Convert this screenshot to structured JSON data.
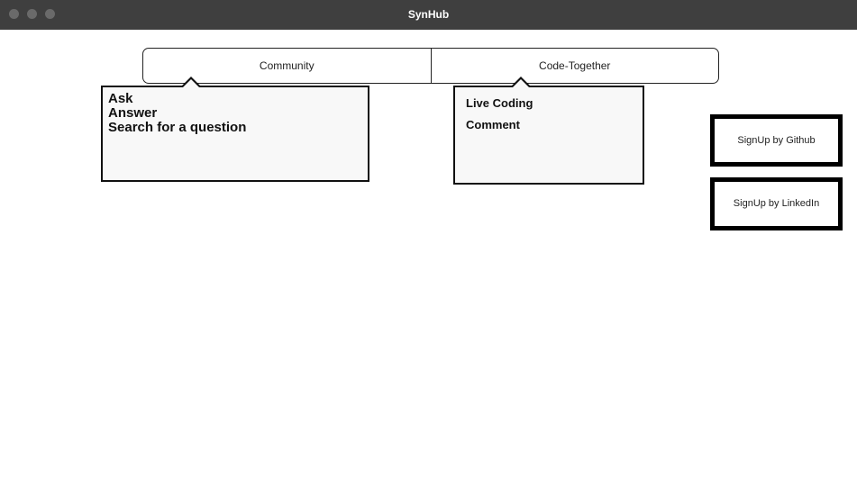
{
  "window": {
    "title": "SynHub"
  },
  "tabs": [
    {
      "label": "Community"
    },
    {
      "label": "Code-Together"
    }
  ],
  "community_menu": {
    "items": [
      {
        "label": "Ask"
      },
      {
        "label": "Answer"
      },
      {
        "label": "Search for a question"
      }
    ]
  },
  "code_menu": {
    "items": [
      {
        "label": "Live Coding"
      },
      {
        "label": "Comment"
      }
    ]
  },
  "signup": {
    "github_label": "SignUp by Github",
    "linkedin_label": "SignUp by LinkedIn"
  }
}
